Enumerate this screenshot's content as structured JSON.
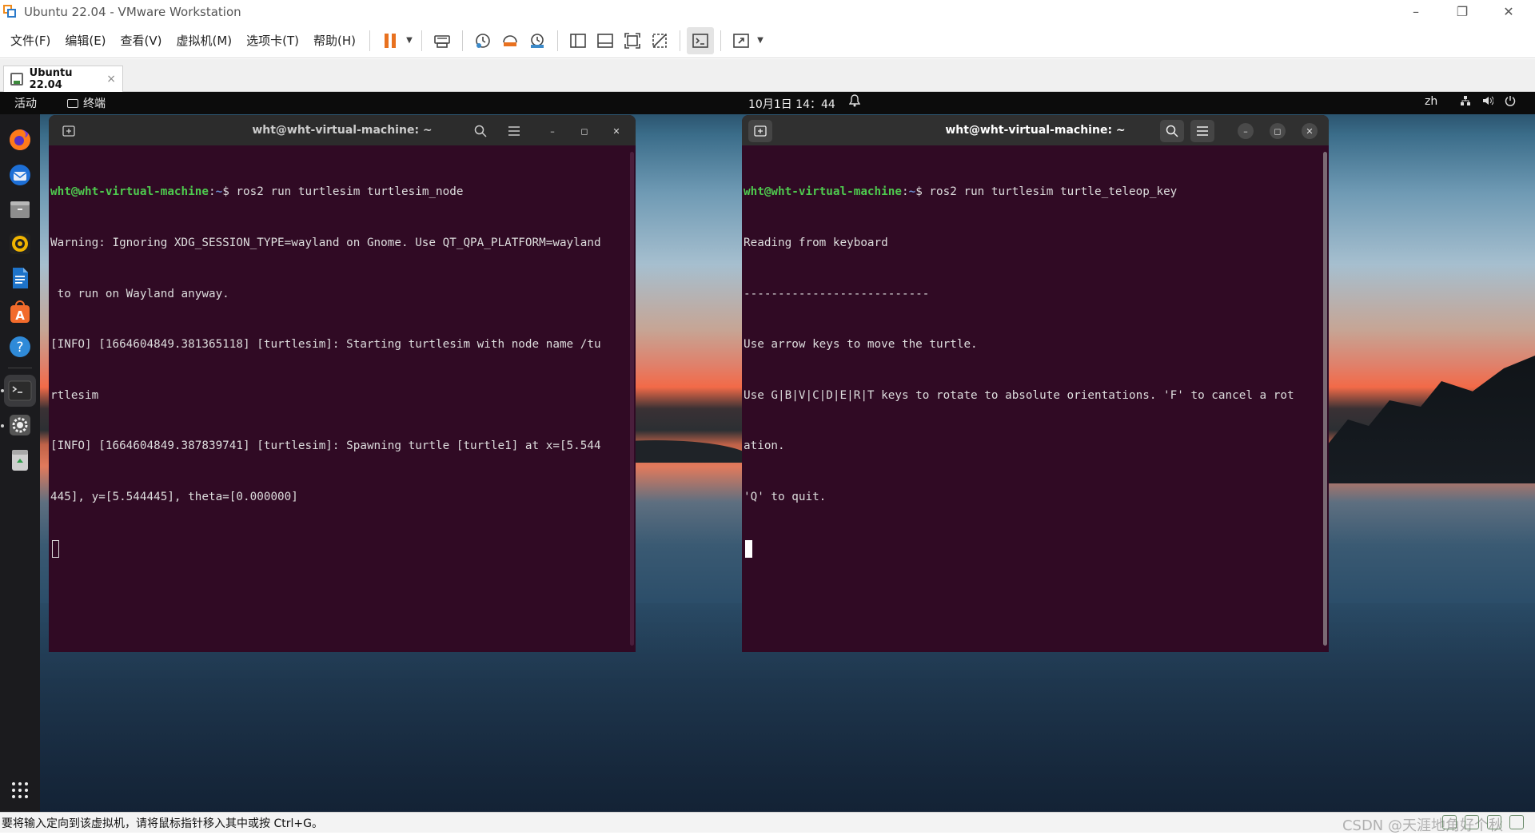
{
  "window": {
    "title": "Ubuntu 22.04 - VMware Workstation",
    "controls": [
      "–",
      "❐",
      "✕"
    ]
  },
  "menu": {
    "items": [
      "文件(F)",
      "编辑(E)",
      "查看(V)",
      "虚拟机(M)",
      "选项卡(T)",
      "帮助(H)"
    ]
  },
  "toolbar": {
    "buttons": [
      "pause",
      "send-ctrl-alt-del",
      "snapshot",
      "revert-snapshot",
      "snapshot-manager",
      "show-library",
      "thumbnail-bar",
      "full-screen",
      "unity",
      "console-view",
      "stretch-guest"
    ]
  },
  "tab": {
    "label": "Ubuntu 22.04",
    "close": "×"
  },
  "gnome": {
    "activities": "活动",
    "app_name": "终端",
    "clock": "10月1日  14：44",
    "lang": "zh",
    "accent": "#e95420",
    "dock": [
      "firefox-icon",
      "thunderbird-icon",
      "files-icon",
      "rhythmbox-icon",
      "writer-icon",
      "software-icon",
      "help-icon",
      "terminal-icon",
      "settings-icon",
      "trash-icon",
      "app-grid-icon"
    ]
  },
  "terminal_left": {
    "title": "wht@wht-virtual-machine: ~",
    "prompt_user": "wht@wht-virtual-machine",
    "prompt_sep": ":",
    "prompt_path": "~",
    "prompt_end": "$ ",
    "command": "ros2 run turtlesim turtlesim_node",
    "lines": [
      "Warning: Ignoring XDG_SESSION_TYPE=wayland on Gnome. Use QT_QPA_PLATFORM=wayland",
      " to run on Wayland anyway.",
      "[INFO] [1664604849.381365118] [turtlesim]: Starting turtlesim with node name /tu",
      "rtlesim",
      "[INFO] [1664604849.387839741] [turtlesim]: Spawning turtle [turtle1] at x=[5.544",
      "445], y=[5.544445], theta=[0.000000]"
    ]
  },
  "terminal_right": {
    "title": "wht@wht-virtual-machine: ~",
    "prompt_user": "wht@wht-virtual-machine",
    "prompt_sep": ":",
    "prompt_path": "~",
    "prompt_end": "$ ",
    "command": "ros2 run turtlesim turtle_teleop_key",
    "lines": [
      "Reading from keyboard",
      "---------------------------",
      "Use arrow keys to move the turtle.",
      "Use G|B|V|C|D|E|R|T keys to rotate to absolute orientations. 'F' to cancel a rot",
      "ation.",
      "'Q' to quit."
    ]
  },
  "statusbar": {
    "message": "要将输入定向到该虚拟机，请将鼠标指针移入其中或按 Ctrl+G。",
    "watermark": "CSDN @天涯地角好个秋"
  }
}
